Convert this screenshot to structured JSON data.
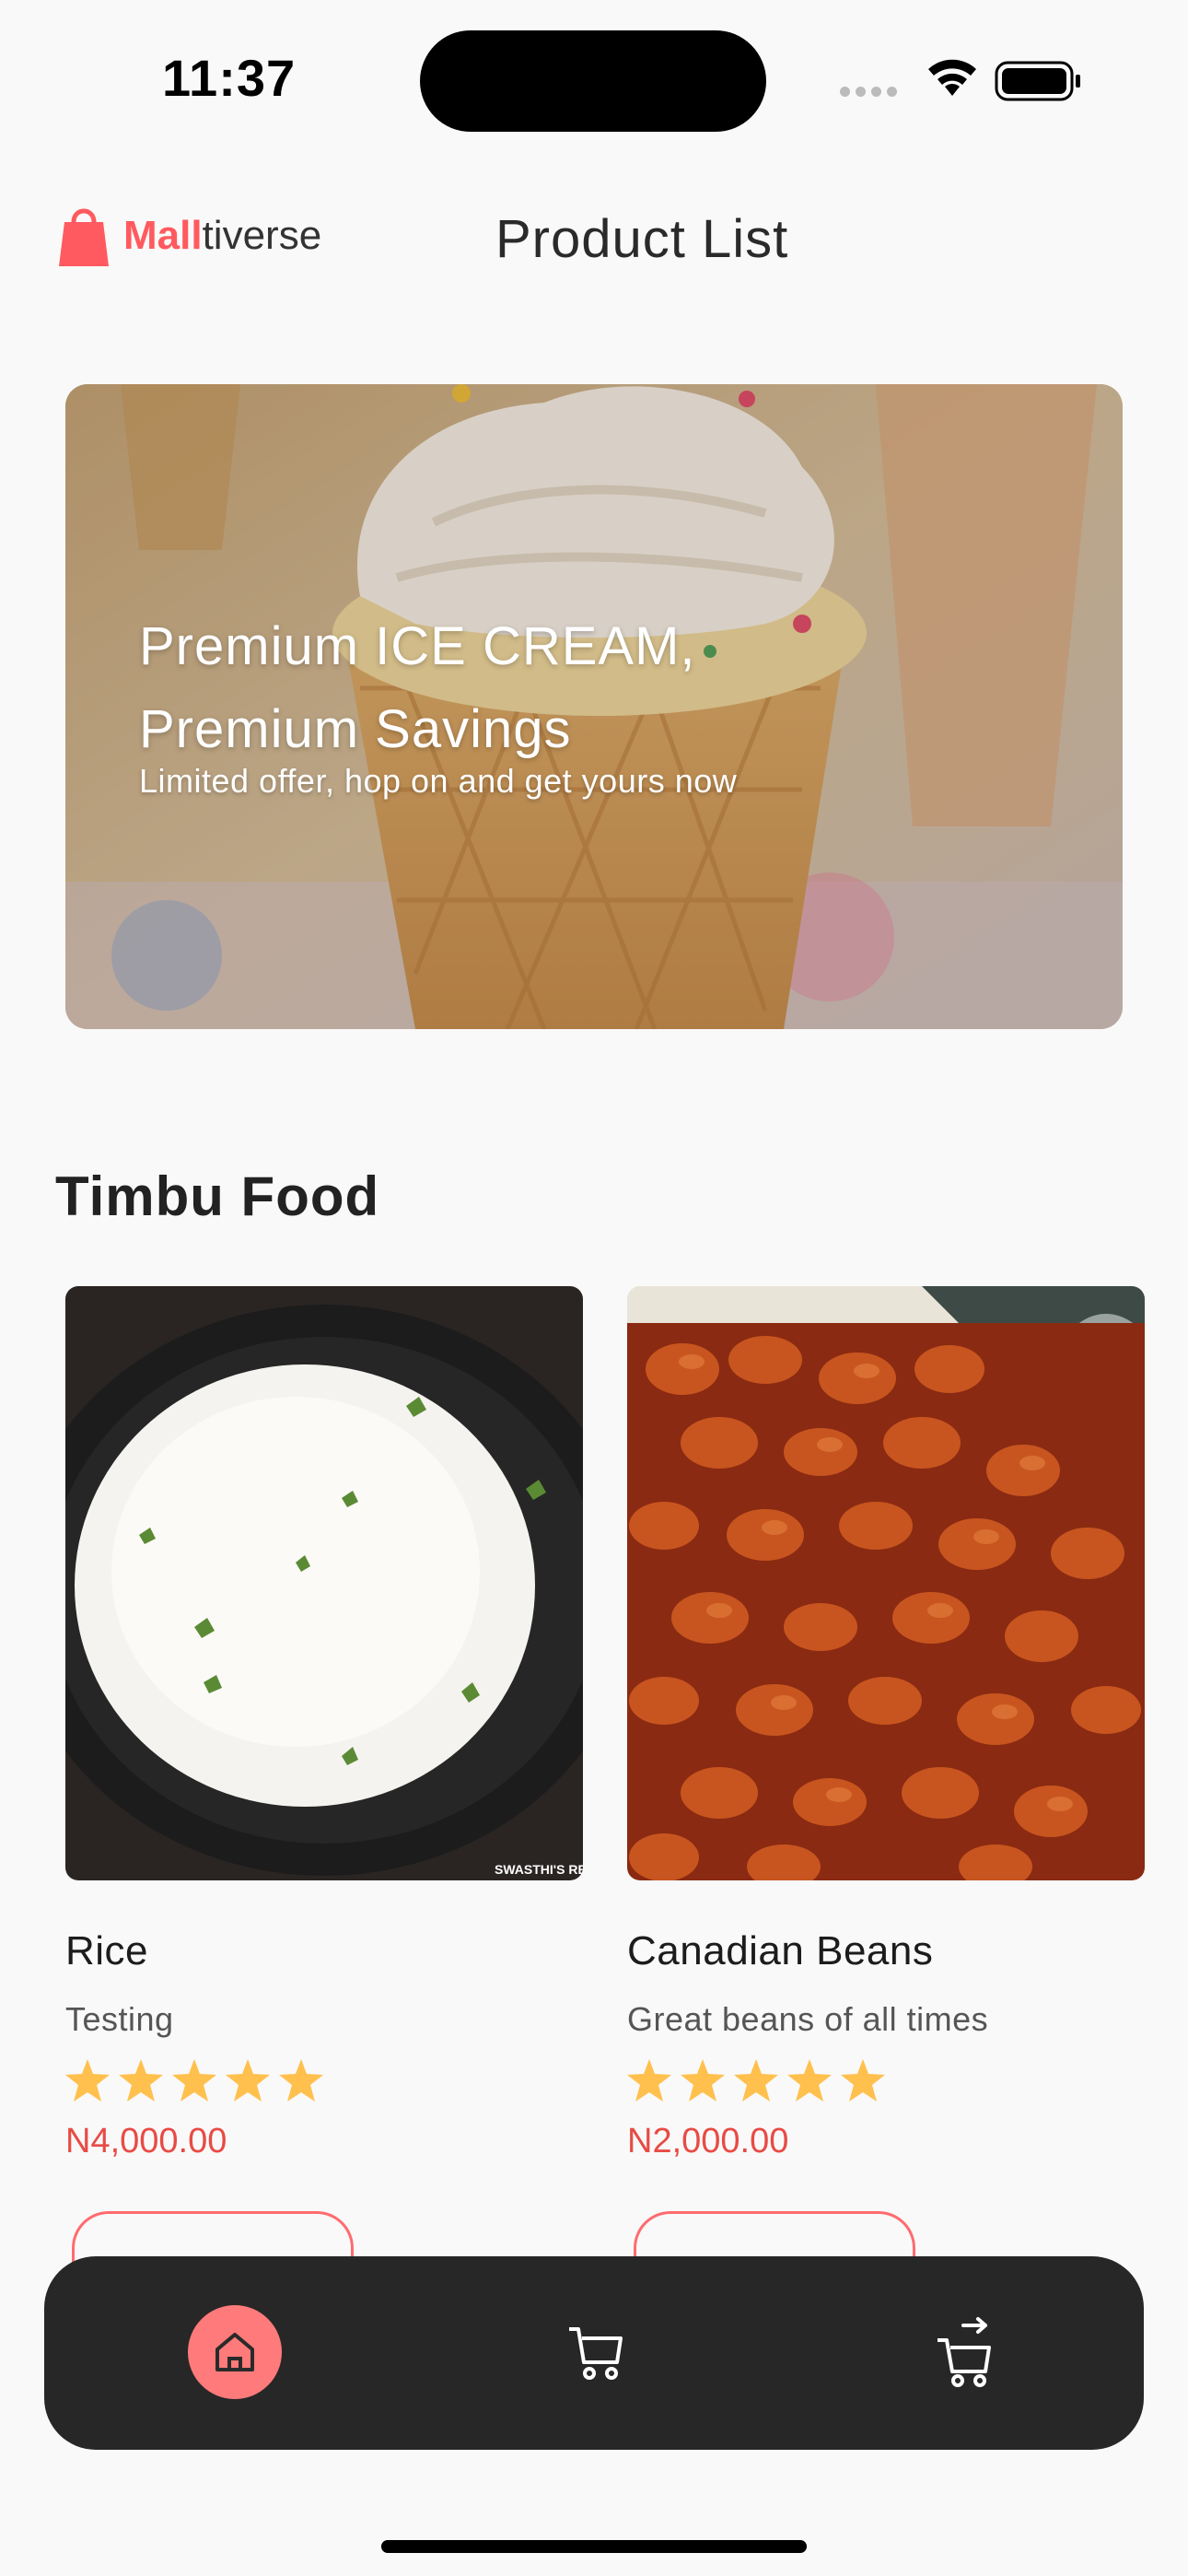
{
  "status_bar": {
    "time": "11:37"
  },
  "header": {
    "logo_mall": "Mall",
    "logo_rest": "tiverse",
    "title": "Product List"
  },
  "banner": {
    "title": "Premium ICE CREAM, Premium Savings",
    "subtitle": "Limited offer, hop on and get yours now"
  },
  "section": {
    "title": "Timbu Food"
  },
  "products": [
    {
      "name": "Rice",
      "description": "Testing",
      "rating": 5,
      "price": "N4,000.00",
      "image_caption": "SWASTHI'S REC"
    },
    {
      "name": "Canadian Beans",
      "description": "Great beans of all times",
      "rating": 5,
      "price": "N2,000.00"
    }
  ],
  "colors": {
    "accent": "#ff5a5f",
    "price": "#e84b45",
    "star": "#ffc04d",
    "nav_bg": "#272727",
    "nav_active": "#ff7a7a"
  },
  "bottom_nav": {
    "items": [
      {
        "icon": "home-icon",
        "active": true
      },
      {
        "icon": "cart-icon",
        "active": false
      },
      {
        "icon": "checkout-cart-icon",
        "active": false
      }
    ]
  }
}
